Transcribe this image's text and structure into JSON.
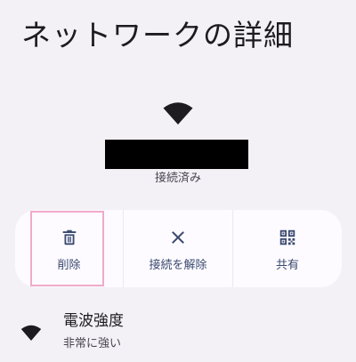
{
  "header": {
    "title": "ネットワークの詳細"
  },
  "network": {
    "status": "接続済み",
    "icon": "wifi-icon"
  },
  "actions": [
    {
      "label": "削除",
      "icon": "trash-icon"
    },
    {
      "label": "接続を解除",
      "icon": "close-icon"
    },
    {
      "label": "共有",
      "icon": "qr-code-icon"
    }
  ],
  "details": {
    "signal": {
      "title": "電波強度",
      "value": "非常に強い",
      "icon": "wifi-icon"
    }
  },
  "colors": {
    "background": "#f3f0f6",
    "card": "#fdfbff",
    "accent": "#3b4a70",
    "highlight": "#f0aacb"
  }
}
